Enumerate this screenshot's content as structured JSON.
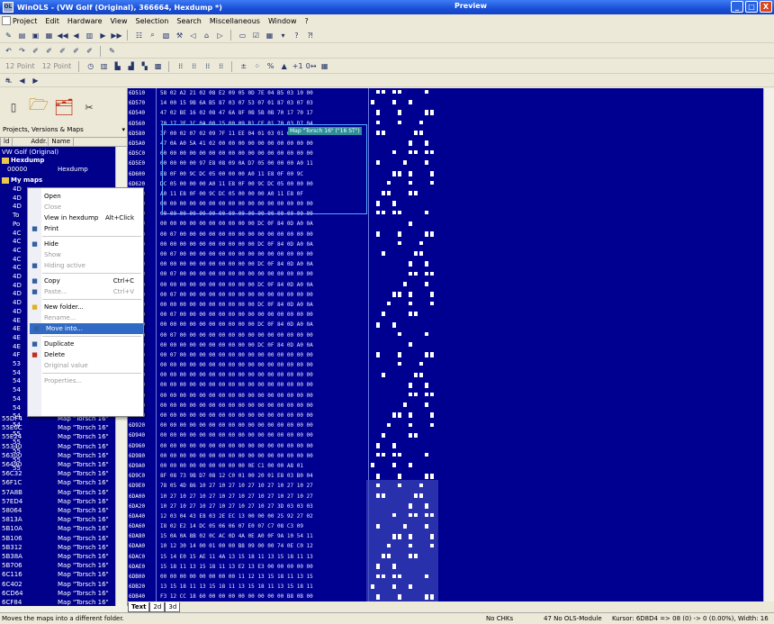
{
  "window": {
    "title": "WinOLS - (VW Golf (Original), 366664, Hexdump *)",
    "preview": "Preview",
    "minimize": "_",
    "maximize": "□",
    "close": "X"
  },
  "menu": [
    "Project",
    "Edit",
    "Hardware",
    "View",
    "Selection",
    "Search",
    "Miscellaneous",
    "Window",
    "?"
  ],
  "toolbar": {
    "point_label_1": "12 Point",
    "point_label_2": "12 Point"
  },
  "left_panel": {
    "header": "Projects, Versions & Maps",
    "header_arrow": "▾",
    "col_icon": "ld",
    "col_addr": "Addr.",
    "col_name": "Name",
    "project": "VW Golf (Original)",
    "hexdump_folder": "Hexdump",
    "hexdump_addr": "00000",
    "hexdump_name": "Hexdump",
    "mymaps": "My maps",
    "short_rows": [
      "4D",
      "4D",
      "4D",
      "To",
      "Po",
      "4C",
      "4C",
      "4C",
      "4C",
      "4C",
      "4D",
      "4D",
      "4D",
      "4D",
      "4D",
      "4E",
      "4E",
      "4E",
      "4E",
      "4F",
      "53",
      "54",
      "54",
      "54",
      "54",
      "54",
      "54",
      "54",
      "55",
      "55",
      "55",
      "55",
      "55"
    ],
    "map_rows": [
      {
        "addr": "55DF4",
        "name": "Map \"Torsch 16\""
      },
      {
        "addr": "55E0C",
        "name": "Map \"Torsch 16\""
      },
      {
        "addr": "55E24",
        "name": "Map \"Torsch 16\""
      },
      {
        "addr": "55340",
        "name": "Map \"Torsch 16\""
      },
      {
        "addr": "56300",
        "name": "Map \"Torsch 16\""
      },
      {
        "addr": "56490",
        "name": "Map \"Torsch 16\""
      },
      {
        "addr": "56C32",
        "name": "Map \"Torsch 16\""
      },
      {
        "addr": "56F1C",
        "name": "Map \"Torsch 16\""
      },
      {
        "addr": "57A8B",
        "name": "Map \"Torsch 16\""
      },
      {
        "addr": "57ED4",
        "name": "Map \"Torsch 16\""
      },
      {
        "addr": "58064",
        "name": "Map \"Torsch 16\""
      },
      {
        "addr": "5813A",
        "name": "Map \"Torsch 16\""
      },
      {
        "addr": "5B10A",
        "name": "Map \"Torsch 16\""
      },
      {
        "addr": "5B106",
        "name": "Map \"Torsch 16\""
      },
      {
        "addr": "5B312",
        "name": "Map \"Torsch 16\""
      },
      {
        "addr": "5B38A",
        "name": "Map \"Torsch 16\""
      },
      {
        "addr": "5B706",
        "name": "Map \"Torsch 16\""
      },
      {
        "addr": "6C116",
        "name": "Map \"Torsch 16\""
      },
      {
        "addr": "6C402",
        "name": "Map \"Torsch 16\""
      },
      {
        "addr": "6CD64",
        "name": "Map \"Torsch 16\""
      },
      {
        "addr": "6CF84",
        "name": "Map \"Torsch 16\""
      }
    ]
  },
  "context_menu": [
    {
      "type": "item",
      "label": "Open",
      "shortcut": "",
      "disabled": false,
      "icon": ""
    },
    {
      "type": "item",
      "label": "Close",
      "shortcut": "",
      "disabled": true,
      "icon": ""
    },
    {
      "type": "item",
      "label": "View in hexdump",
      "shortcut": "Alt+Click",
      "disabled": false,
      "icon": ""
    },
    {
      "type": "item",
      "label": "Print",
      "shortcut": "",
      "disabled": false,
      "icon": "printer-icon"
    },
    {
      "type": "sep"
    },
    {
      "type": "item",
      "label": "Hide",
      "shortcut": "",
      "disabled": false,
      "icon": "hide-icon"
    },
    {
      "type": "item",
      "label": "Show",
      "shortcut": "",
      "disabled": true,
      "icon": ""
    },
    {
      "type": "item",
      "label": "Hiding active",
      "shortcut": "",
      "disabled": true,
      "icon": "hiding-icon"
    },
    {
      "type": "sep"
    },
    {
      "type": "item",
      "label": "Copy",
      "shortcut": "Ctrl+C",
      "disabled": false,
      "icon": "copy-icon"
    },
    {
      "type": "item",
      "label": "Paste...",
      "shortcut": "Ctrl+V",
      "disabled": true,
      "icon": "paste-icon"
    },
    {
      "type": "sep"
    },
    {
      "type": "item",
      "label": "New folder...",
      "shortcut": "",
      "disabled": false,
      "icon": "folder-icon"
    },
    {
      "type": "item",
      "label": "Rename...",
      "shortcut": "",
      "disabled": true,
      "icon": ""
    },
    {
      "type": "item",
      "label": "Move into...",
      "shortcut": "",
      "disabled": false,
      "icon": "move-icon",
      "selected": true
    },
    {
      "type": "sep"
    },
    {
      "type": "item",
      "label": "Duplicate",
      "shortcut": "",
      "disabled": false,
      "icon": "duplicate-icon"
    },
    {
      "type": "item",
      "label": "Delete",
      "shortcut": "",
      "disabled": false,
      "icon": "delete-icon"
    },
    {
      "type": "item",
      "label": "Original value",
      "shortcut": "",
      "disabled": true,
      "icon": ""
    },
    {
      "type": "sep"
    },
    {
      "type": "item",
      "label": "Properties...",
      "shortcut": "",
      "disabled": true,
      "icon": ""
    }
  ],
  "hex": {
    "offsets": [
      "6D510",
      "6D570",
      "6D540",
      "6D560",
      "6D580",
      "6D5A0",
      "6D5C0",
      "6D5E0",
      "6D600",
      "6D620",
      "6D640",
      "6D660",
      "6D680",
      "6D6A0",
      "6D6C0",
      "6D6E0",
      "6D700",
      "6D720",
      "6D740",
      "6D760",
      "6D780",
      "6D7A0",
      "6D7C0",
      "6D7E0",
      "6D800",
      "6D820",
      "6D840",
      "6D860",
      "6D880",
      "6D8A0",
      "6D8C0",
      "6D8E0",
      "6D900",
      "6D920",
      "6D940",
      "6D960",
      "6D980",
      "6D9A0",
      "6D9C0",
      "6D9E0",
      "6DA00",
      "6DA20",
      "6DA40",
      "6DA60",
      "6DA80",
      "6DAA0",
      "6DAC0",
      "6DAE0",
      "6DB00",
      "6DB20",
      "6DB40",
      "6DB60"
    ],
    "rows": [
      "58 02 A2 21 02 08 E2 09 05 0D 7E 04 B5 03 10 00",
      "14 00 15 9B 6A B5 87 03 07 53 07 01 87 03 07 03",
      "47 02 BE 16 02 08 47 6A 8F 0B 5B 0B 70 17 70 17",
      "70 17 2E 1C 0A 08 15 00 09 B1 CE 01 70 03 D7 04",
      "3F 00 02 07 02 09 7F 11 EE 04 01 03 01 00 02 07",
      "47 0A A0 5A 41 02 00 00 00 00 00 00 00 00 00 00",
      "00 00 00 00 00 00 00 00 00 00 00 00 00 00 00 00",
      "00 00 00 00 97 E8 08 09 0A D7 05 00 00 00 A0 11",
      "E8 0F 00 9C DC 05 00 00 00 A0 11 E8 0F 00 9C",
      "DC 05 00 00 00 A0 11 E8 0F 00 9C DC 05 00 00 00",
      "A0 11 E8 0F 00 9C DC 05 00 00 00 A0 11 E8 0F",
      "00 00 00 00 00 00 00 00 00 00 00 00 00 00 00 00",
      "00 00 00 00 00 00 00 00 00 00 00 00 00 00 00 00",
      "00 00 00 00 00 00 00 00 00 00 DC 0F 84 0D A0 0A",
      "00 07 00 00 00 00 00 00 00 00 00 00 00 00 00 00",
      "00 00 00 00 00 00 00 00 00 00 DC 0F 84 0D A0 0A",
      "00 07 00 00 00 00 00 00 00 00 00 00 00 00 00 00",
      "00 00 00 00 00 00 00 00 00 00 DC 0F 84 0D A0 0A",
      "00 07 00 00 00 00 00 00 00 00 00 00 00 00 00 00",
      "00 00 00 00 00 00 00 00 00 00 DC 0F 84 0D A0 0A",
      "00 07 00 00 00 00 00 00 00 00 00 00 00 00 00 00",
      "00 00 00 00 00 00 00 00 00 00 DC 0F 84 0D A0 0A",
      "00 07 00 00 00 00 00 00 00 00 00 00 00 00 00 00",
      "00 00 00 00 00 00 00 00 00 00 DC 0F 84 0D A0 0A",
      "00 07 00 00 00 00 00 00 00 00 00 00 00 00 00 00",
      "00 00 00 00 00 00 00 00 00 00 DC 0F 84 0D A0 0A",
      "00 07 00 00 00 00 00 00 00 00 00 00 00 00 00 00",
      "00 00 00 00 00 00 00 00 00 00 00 00 00 00 00 00",
      "00 00 00 00 00 00 00 00 00 00 00 00 00 00 00 00",
      "00 00 00 00 00 00 00 00 00 00 00 00 00 00 00 00",
      "00 00 00 00 00 00 00 00 00 00 00 00 00 00 00 00",
      "00 00 00 00 00 00 00 00 00 00 00 00 00 00 00 00",
      "00 00 00 00 00 00 00 00 00 00 00 00 00 00 00 00",
      "00 00 00 00 00 00 00 00 00 00 00 00 00 00 00 00",
      "00 00 00 00 00 00 00 00 00 00 00 00 00 00 00 00",
      "00 00 00 00 00 00 00 00 00 00 00 00 00 00 00 00",
      "00 00 00 00 00 00 00 00 00 00 00 00 00 00 00 00",
      "00 00 00 00 00 00 00 00 00 0E C1 00 00 A8 01",
      "8F 08 73 9B D7 08 12 C0 01 00 20 01 E8 03 B0 04",
      "78 05 4D 86 10 27 10 27 10 27 10 27 10 27 10 27",
      "10 27 10 27 10 27 10 27 10 27 10 27 10 27 10 27",
      "10 27 10 27 10 27 10 27 10 27 10 27 3D 03 03 03",
      "12 03 04 43 E8 03 2E EC 13 00 00 00 25 92 27 02",
      "I8 02 E2 14 DC 05 06 06 07 E0 07 C7 08 C3 09",
      "15 0A 0A 8B 02 0C AC 0D 4A 0E A0 0F 9A 10 54 11",
      "10 12 30 14 00 01 00 00 B8 09 00 00 74 0E C0 12",
      "15 14 E0 15 AE 11 4A 13 15 18 11 13 15 18 11 13",
      "15 18 11 13 15 18 11 13 E2 13 E3 00 00 00 00 00",
      "00 00 00 00 00 00 00 00 11 12 13 15 18 11 13 15",
      "13 15 18 11 13 15 18 11 13 15 18 11 13 15 18 11",
      "F3 12 CC 18 60 00 00 00 00 00 00 00 00 B8 0B 00",
      "30 00 00 0C DB 0E 5C 0E 7C 8A 70 0E 8C 0E 90 00"
    ],
    "map_label": "Map \"Torsch 16\" (\"16 ST\")",
    "ascii_pattern": [
      [
        0,
        1,
        1,
        0,
        1,
        1,
        0,
        0,
        0,
        0,
        1,
        0
      ],
      [
        0,
        1,
        0,
        0,
        0,
        1,
        0,
        0,
        1,
        0,
        0,
        0
      ],
      [
        1,
        1,
        0,
        1,
        0,
        0,
        0,
        1,
        0,
        0,
        0,
        0
      ],
      [
        1,
        0,
        0,
        0,
        1,
        0,
        0,
        0,
        1,
        0,
        0,
        0
      ],
      [
        1,
        1,
        0,
        0,
        0,
        1,
        1,
        0,
        0,
        0,
        0,
        0
      ],
      [
        1,
        0,
        0,
        1,
        0,
        0,
        0,
        0,
        0,
        0,
        0,
        0
      ]
    ]
  },
  "tabs": [
    "Text",
    "2d",
    "3d"
  ],
  "status": {
    "message": "Moves the maps into a different folder.",
    "crc": "No CHKs",
    "module": "47 No OLS-Module",
    "cursor": "Kursor: 6D8D4 => 08 (0) -> 0 (0.00%), Width: 16"
  }
}
